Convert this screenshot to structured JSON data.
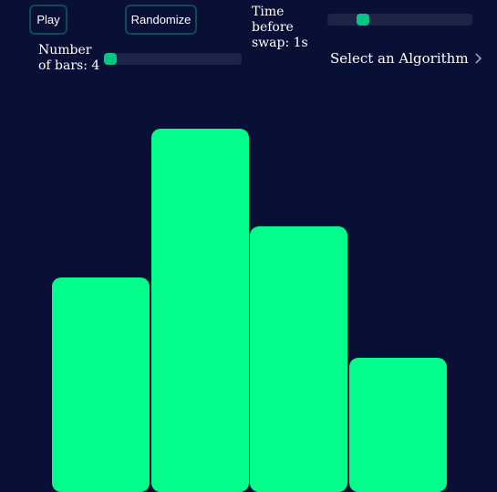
{
  "controls": {
    "play_label": "Play",
    "randomize_label": "Randomize",
    "time_label": "Time before swap: 1s",
    "bars_label": "Number of bars: 4",
    "algorithm_label": "Select an Algorithm",
    "time_slider_value_fraction": 0.22,
    "bars_slider_value_fraction": 0.0
  },
  "bars": {
    "count": 4,
    "heights_relative": [
      0.59,
      1.0,
      0.73,
      0.37
    ],
    "color": "#02fd8d"
  },
  "colors": {
    "background": "#0a0f35",
    "accent": "#04c584",
    "button_border": "#0d4a52",
    "slider_track": "#1f2447"
  },
  "icons": {
    "algorithm_dropdown": "chevron-right-icon"
  }
}
